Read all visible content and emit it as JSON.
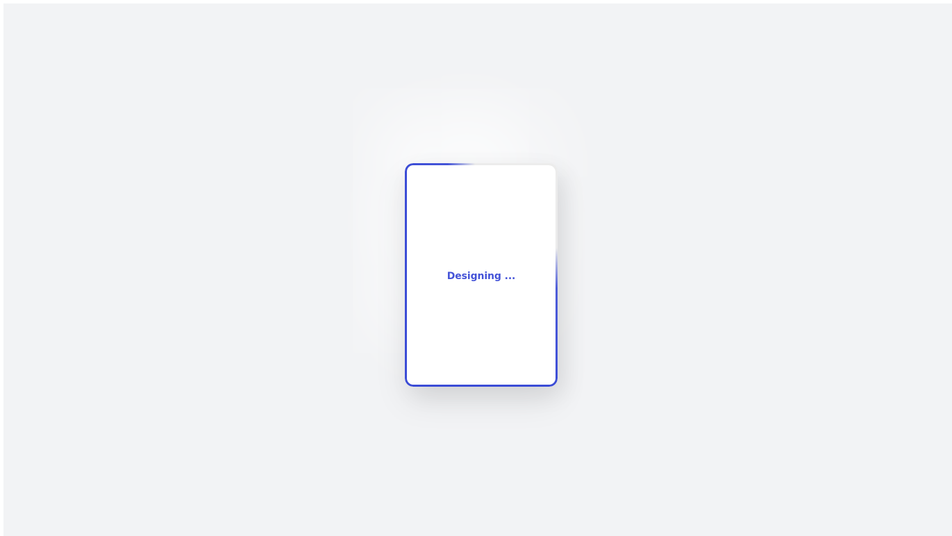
{
  "loading": {
    "text": "Designing ..."
  },
  "colors": {
    "background": "#f2f3f5",
    "card": "#ffffff",
    "accent": "#4453d8"
  }
}
